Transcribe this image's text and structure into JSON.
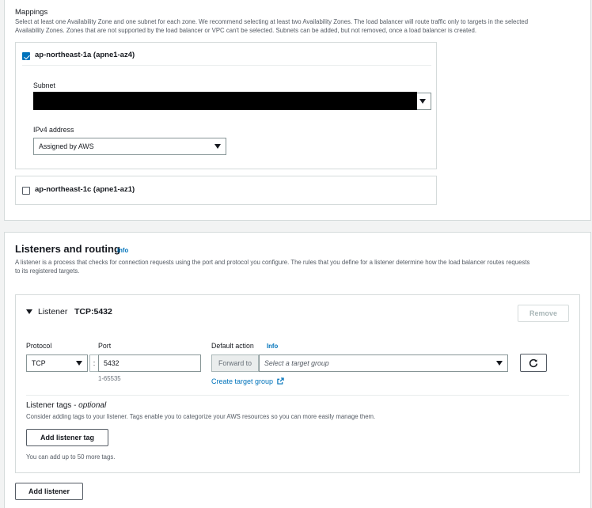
{
  "mappings": {
    "label": "Mappings",
    "description_line1": "Select at least one Availability Zone and one subnet for each zone. We recommend selecting at least two Availability Zones. The load balancer will route traffic only to targets in the selected",
    "description_line2": "Availability Zones. Zones that are not supported by the load balancer or VPC can't be selected. Subnets can be added, but not removed, once a load balancer is created.",
    "zones": [
      {
        "label": "ap-northeast-1a (apne1-az4)",
        "checked": true,
        "subnet_label": "Subnet",
        "ipv4_label": "IPv4 address",
        "ipv4_value": "Assigned by AWS"
      },
      {
        "label": "ap-northeast-1c (apne1-az1)",
        "checked": false
      }
    ]
  },
  "listeners": {
    "title": "Listeners and routing",
    "info": "Info",
    "description_line1": "A listener is a process that checks for connection requests using the port and protocol you configure. The rules that you define for a listener determine how the load balancer routes requests",
    "description_line2": "to its registered targets.",
    "listener": {
      "label": "Listener",
      "name": "TCP:5432",
      "remove_label": "Remove",
      "protocol_label": "Protocol",
      "protocol_value": "TCP",
      "port_label": "Port",
      "port_value": "5432",
      "port_hint": "1-65535",
      "separator": ":",
      "default_action_label": "Default action",
      "default_action_info": "Info",
      "forward_to": "Forward to",
      "target_group_placeholder": "Select a target group",
      "create_target_group": "Create target group",
      "tags_title": "Listener tags",
      "tags_optional": "- optional",
      "tags_description": "Consider adding tags to your listener. Tags enable you to categorize your AWS resources so you can more easily manage them.",
      "add_tag_label": "Add listener tag",
      "tags_hint": "You can add up to 50 more tags."
    },
    "add_listener_label": "Add listener"
  },
  "colors": {
    "accent": "#0073bb",
    "border": "#d5dbdb",
    "page_bg": "#f2f3f3"
  }
}
